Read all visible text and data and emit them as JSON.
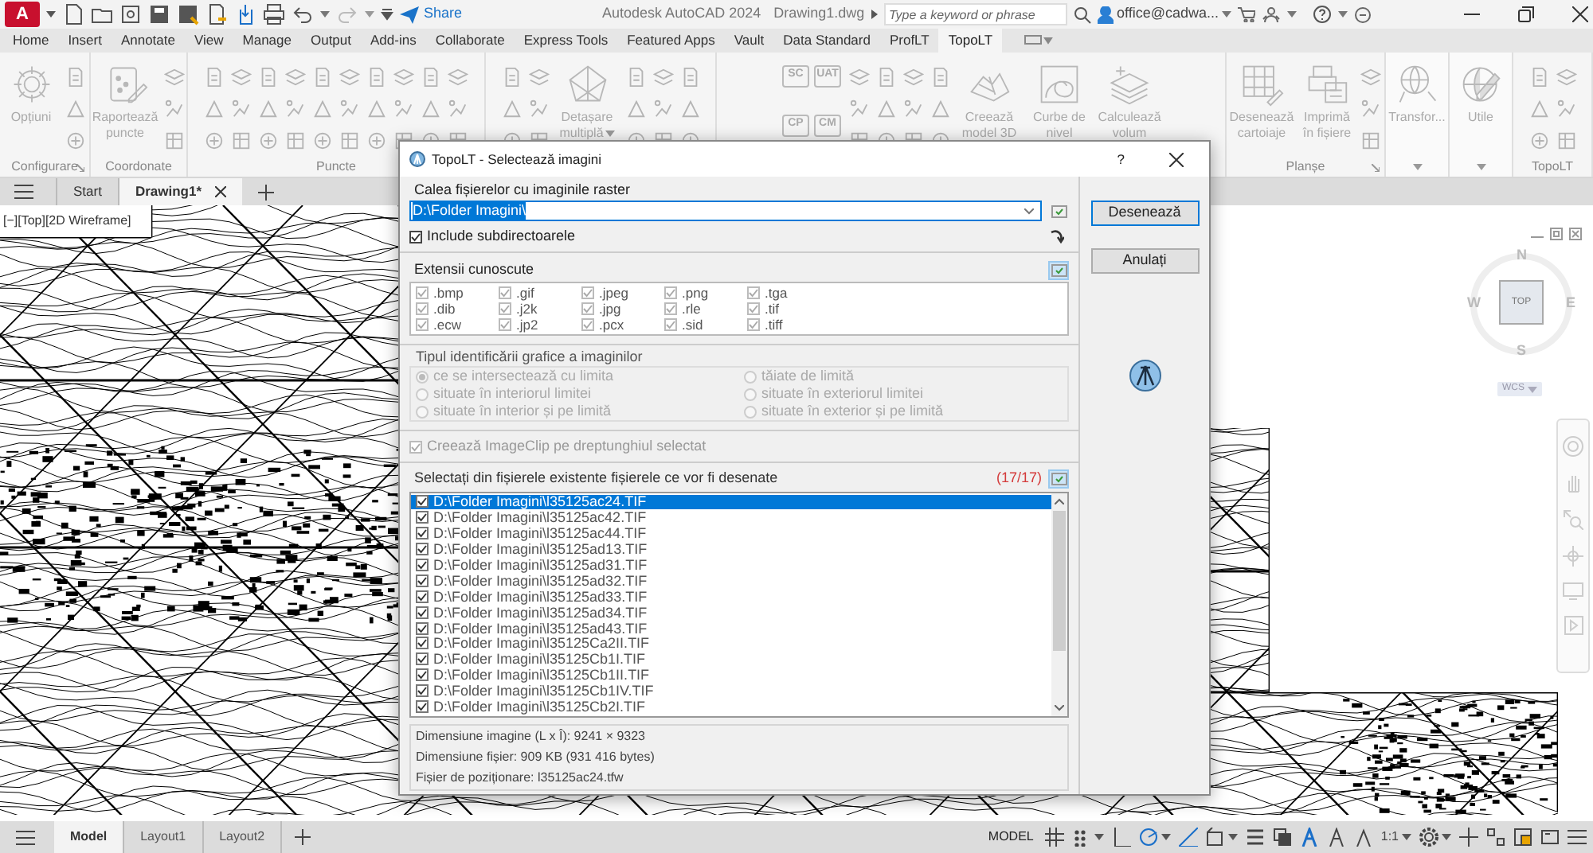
{
  "title_bar": {
    "app_button": "A",
    "share": "Share",
    "app_title": "Autodesk AutoCAD 2024",
    "file_name": "Drawing1.dwg",
    "search": {
      "placeholder": "Type a keyword or phrase"
    },
    "user": "office@cadwa..."
  },
  "ribbon_tabs": [
    {
      "label": "Home",
      "selected": false
    },
    {
      "label": "Insert",
      "selected": false
    },
    {
      "label": "Annotate",
      "selected": false
    },
    {
      "label": "View",
      "selected": false
    },
    {
      "label": "Manage",
      "selected": false
    },
    {
      "label": "Output",
      "selected": false
    },
    {
      "label": "Add-ins",
      "selected": false
    },
    {
      "label": "Collaborate",
      "selected": false
    },
    {
      "label": "Express Tools",
      "selected": false
    },
    {
      "label": "Featured Apps",
      "selected": false
    },
    {
      "label": "Vault",
      "selected": false
    },
    {
      "label": "Data Standard",
      "selected": false
    },
    {
      "label": "ProfLT",
      "selected": false
    },
    {
      "label": "TopoLT",
      "selected": true
    }
  ],
  "ribbon_panels": [
    {
      "title": "Configurare",
      "launcher": true,
      "buttons": [
        {
          "label": "Opțiuni"
        }
      ]
    },
    {
      "title": "Coordonate",
      "buttons": [
        {
          "label": "Raportează puncte"
        }
      ]
    },
    {
      "title": "Puncte"
    },
    {
      "buttons": [
        {
          "label": "Detașare multiplă",
          "dropdown": true
        }
      ]
    },
    {
      "labeled_icons": [
        "SC",
        "UAT",
        "CP",
        "CM"
      ],
      "buttons": [
        {
          "label": "Creează model 3D"
        },
        {
          "label": "Curbe de nivel"
        },
        {
          "label": "Calculează volum"
        }
      ]
    },
    {
      "title": "Planșe",
      "launcher": true,
      "buttons": [
        {
          "label": "Desenează cartoiaje"
        },
        {
          "label": "Imprimă în fișiere"
        }
      ]
    },
    {
      "menu_arrow": true,
      "buttons": [
        {
          "label": "Transfor..."
        }
      ]
    },
    {
      "menu_arrow": true,
      "buttons": [
        {
          "label": "Utile"
        }
      ]
    },
    {
      "title": "TopoLT"
    }
  ],
  "file_tabs": [
    {
      "label": "Start",
      "selected": false
    },
    {
      "label": "Drawing1*",
      "selected": true
    }
  ],
  "viewport_label": "[−][Top][2D Wireframe]",
  "view_cube": {
    "north": "N",
    "west": "W",
    "east": "E",
    "south": "S",
    "face": "TOP",
    "ucs": "WCS"
  },
  "dialog": {
    "title": "TopoLT - Selectează imagini",
    "help": "?",
    "path_label": "Calea fișierelor cu imaginile raster",
    "path": {
      "value": "D:\\Folder Imagini\\"
    },
    "include_subdirs": {
      "label": "Include subdirectoarele",
      "checked": true
    },
    "extensions": {
      "title": "Extensii cunoscute",
      "items": [
        {
          "label": ".bmp",
          "checked": true
        },
        {
          "label": ".gif",
          "checked": true
        },
        {
          "label": ".jpeg",
          "checked": true
        },
        {
          "label": ".png",
          "checked": true
        },
        {
          "label": ".tga",
          "checked": true
        },
        {
          "label": ".dib",
          "checked": true
        },
        {
          "label": ".j2k",
          "checked": true
        },
        {
          "label": ".jpg",
          "checked": true
        },
        {
          "label": ".rle",
          "checked": true
        },
        {
          "label": ".tif",
          "checked": true
        },
        {
          "label": ".ecw",
          "checked": true
        },
        {
          "label": ".jp2",
          "checked": true
        },
        {
          "label": ".pcx",
          "checked": true
        },
        {
          "label": ".sid",
          "checked": true
        },
        {
          "label": ".tiff",
          "checked": true
        }
      ]
    },
    "identification": {
      "title": "Tipul identificării grafice a imaginilor",
      "disabled": true,
      "options": [
        {
          "label": "ce se intersectează cu limita",
          "selected": true
        },
        {
          "label": "tăiate de limită",
          "selected": false
        },
        {
          "label": "situate în interiorul limitei",
          "selected": false
        },
        {
          "label": "situate în exteriorul limitei",
          "selected": false
        },
        {
          "label": "situate în interior și pe limită",
          "selected": false
        },
        {
          "label": "situate în exterior și pe limită",
          "selected": false
        }
      ]
    },
    "imageclip": {
      "label": "Creează ImageClip pe dreptunghiul selectat",
      "checked": true,
      "disabled": true
    },
    "files": {
      "title": "Selectați din fișierele existente fișierele ce vor fi desenate",
      "count": "(17/17)",
      "items": [
        {
          "path": "D:\\Folder Imagini\\l35125ac24.TIF",
          "checked": true,
          "selected": true
        },
        {
          "path": "D:\\Folder Imagini\\l35125ac42.TIF",
          "checked": true,
          "selected": false
        },
        {
          "path": "D:\\Folder Imagini\\l35125ac44.TIF",
          "checked": true,
          "selected": false
        },
        {
          "path": "D:\\Folder Imagini\\l35125ad13.TIF",
          "checked": true,
          "selected": false
        },
        {
          "path": "D:\\Folder Imagini\\l35125ad31.TIF",
          "checked": true,
          "selected": false
        },
        {
          "path": "D:\\Folder Imagini\\l35125ad32.TIF",
          "checked": true,
          "selected": false
        },
        {
          "path": "D:\\Folder Imagini\\l35125ad33.TIF",
          "checked": true,
          "selected": false
        },
        {
          "path": "D:\\Folder Imagini\\l35125ad34.TIF",
          "checked": true,
          "selected": false
        },
        {
          "path": "D:\\Folder Imagini\\l35125ad43.TIF",
          "checked": true,
          "selected": false
        },
        {
          "path": "D:\\Folder Imagini\\l35125Ca2II.TIF",
          "checked": true,
          "selected": false
        },
        {
          "path": "D:\\Folder Imagini\\l35125Cb1I.TIF",
          "checked": true,
          "selected": false
        },
        {
          "path": "D:\\Folder Imagini\\l35125Cb1II.TIF",
          "checked": true,
          "selected": false
        },
        {
          "path": "D:\\Folder Imagini\\l35125Cb1IV.TIF",
          "checked": true,
          "selected": false
        },
        {
          "path": "D:\\Folder Imagini\\l35125Cb2I.TIF",
          "checked": true,
          "selected": false
        }
      ]
    },
    "info": [
      "Dimensiune imagine (L x Î): 9241 × 9323",
      "Dimensiune fișier: 909 KB (931 416 bytes)",
      "Fișier de poziționare: l35125ac24.tfw"
    ],
    "buttons": [
      {
        "label": "Desenează",
        "default": true
      },
      {
        "label": "Anulați",
        "default": false
      }
    ]
  },
  "layout_tabs": [
    {
      "label": "Model",
      "selected": true
    },
    {
      "label": "Layout1",
      "selected": false
    },
    {
      "label": "Layout2",
      "selected": false
    }
  ],
  "status_bar": {
    "model_button": "MODEL",
    "scale": "1:1"
  }
}
